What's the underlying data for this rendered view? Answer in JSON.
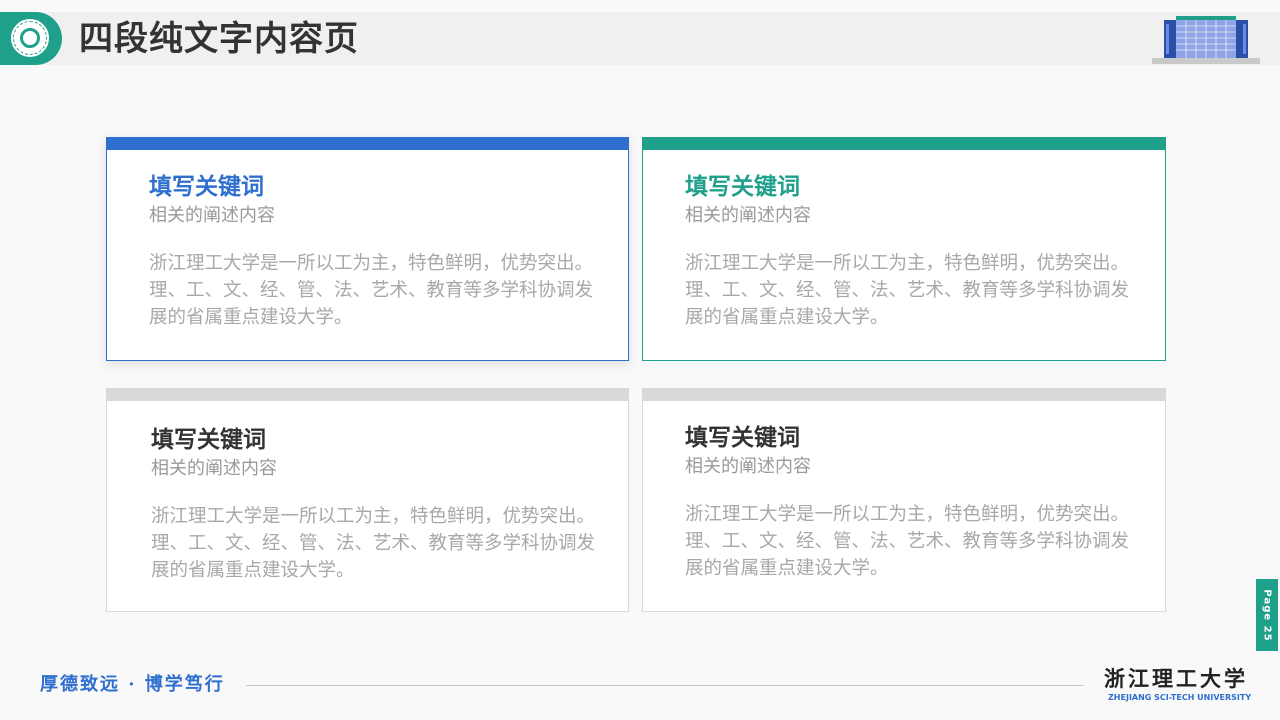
{
  "header": {
    "title": "四段纯文字内容页"
  },
  "cards": [
    {
      "title": "填写关键词",
      "subtitle": "相关的阐述内容",
      "body": "浙江理工大学是一所以工为主，特色鲜明，优势突出。理、工、文、经、管、法、艺术、教育等多学科协调发展的省属重点建设大学。",
      "accent": "#2f6fcf"
    },
    {
      "title": "填写关键词",
      "subtitle": "相关的阐述内容",
      "body": "浙江理工大学是一所以工为主，特色鲜明，优势突出。理、工、文、经、管、法、艺术、教育等多学科协调发展的省属重点建设大学。",
      "accent": "#1fa08b"
    },
    {
      "title": "填写关键词",
      "subtitle": "相关的阐述内容",
      "body": "浙江理工大学是一所以工为主，特色鲜明，优势突出。理、工、文、经、管、法、艺术、教育等多学科协调发展的省属重点建设大学。",
      "accent": "#d9d9d9"
    },
    {
      "title": "填写关键词",
      "subtitle": "相关的阐述内容",
      "body": "浙江理工大学是一所以工为主，特色鲜明，优势突出。理、工、文、经、管、法、艺术、教育等多学科协调发展的省属重点建设大学。",
      "accent": "#d9d9d9"
    }
  ],
  "page_tab": {
    "label": "Page 25"
  },
  "footer": {
    "motto": "厚德致远 · 博学笃行",
    "university_cn": "浙江理工大学",
    "university_en": "ZHEJIANG SCI-TECH UNIVERSITY"
  },
  "icons": {
    "logo": "university-emblem-icon",
    "building": "campus-building-icon"
  },
  "colors": {
    "brand_blue": "#2f6fcf",
    "brand_green": "#1fa08b",
    "neutral": "#d9d9d9"
  }
}
